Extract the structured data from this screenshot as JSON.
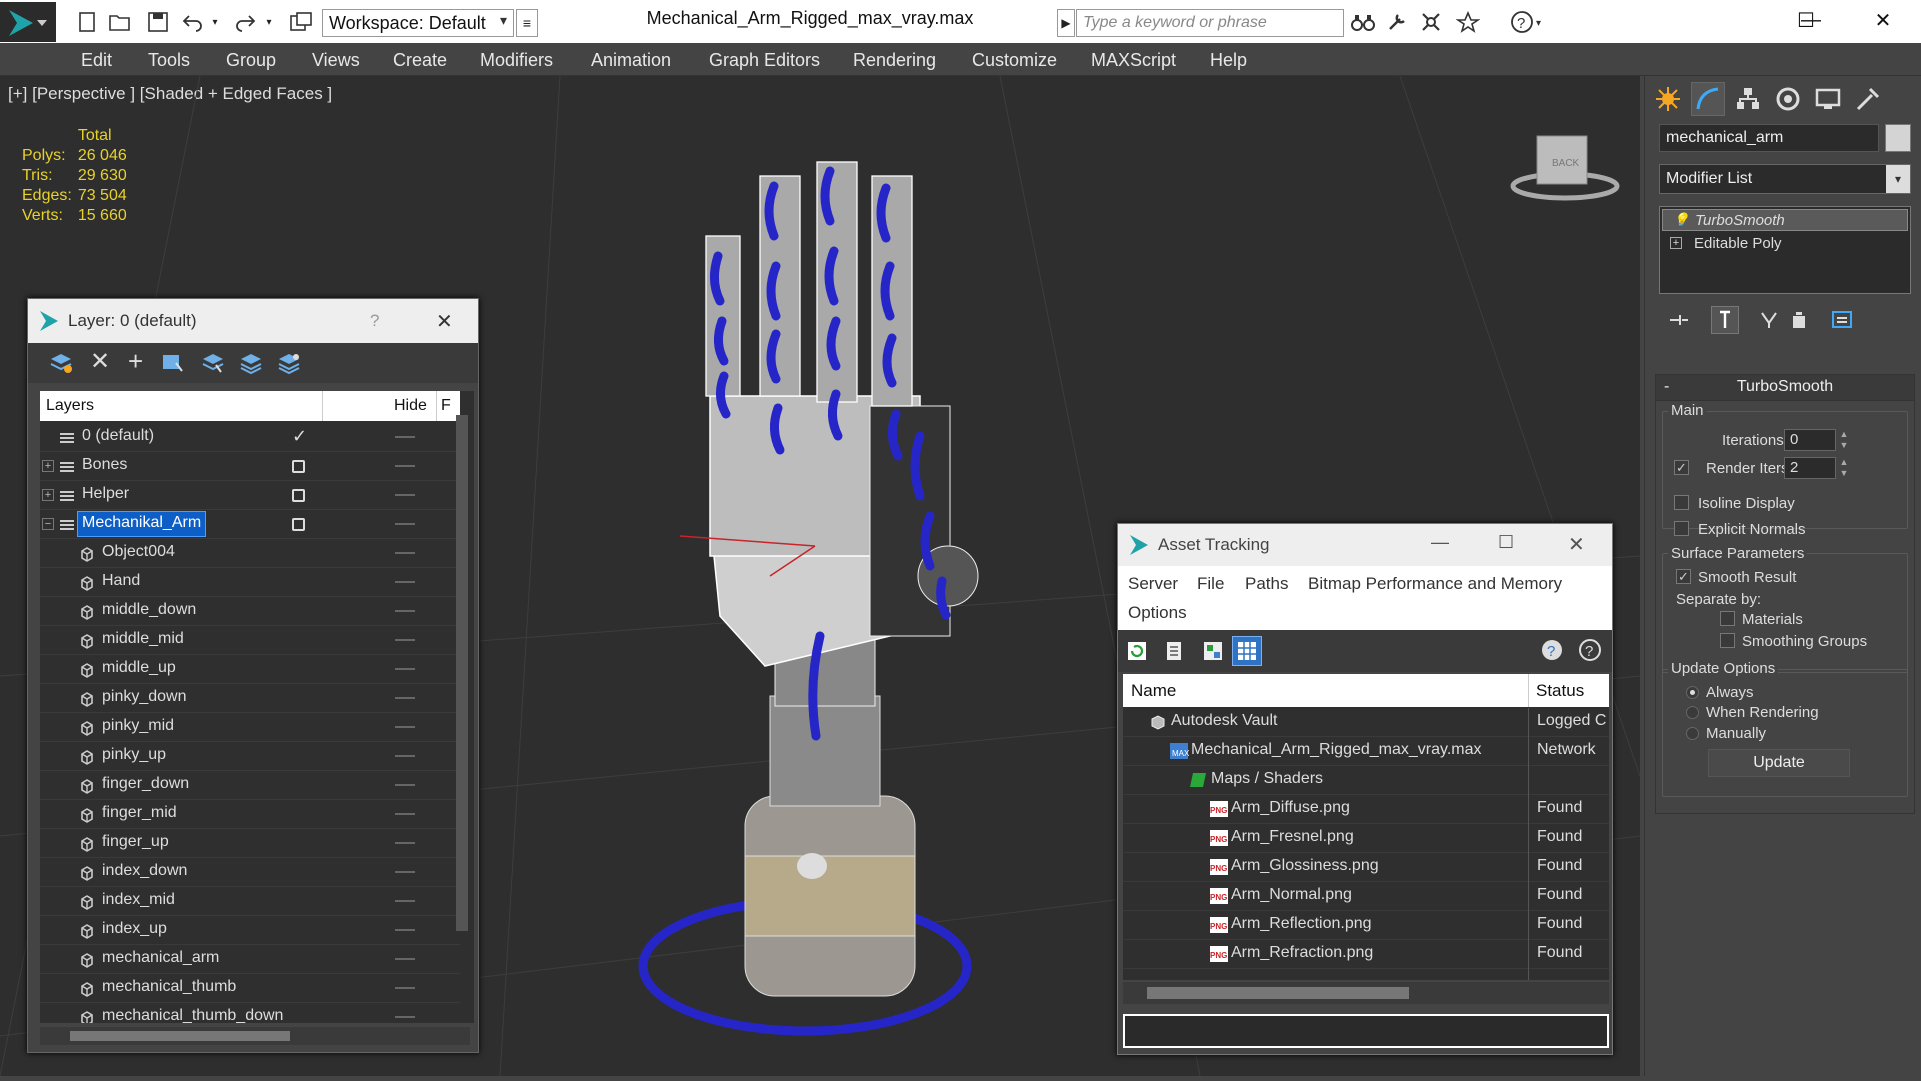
{
  "titlebar": {
    "workspace": "Workspace: Default",
    "doc_title": "Mechanical_Arm_Rigged_max_vray.max",
    "search_placeholder": "Type a keyword or phrase",
    "win_min": "—",
    "win_max": "☐",
    "win_close": "✕"
  },
  "menubar": [
    "Edit",
    "Tools",
    "Group",
    "Views",
    "Create",
    "Modifiers",
    "Animation",
    "Graph Editors",
    "Rendering",
    "Customize",
    "MAXScript",
    "Help"
  ],
  "viewport": {
    "label": "[+] [Perspective ] [Shaded + Edged Faces ]",
    "stats_header": "Total",
    "stats": [
      {
        "label": "Polys:",
        "value": "26 046"
      },
      {
        "label": "Tris:",
        "value": "29 630"
      },
      {
        "label": "Edges:",
        "value": "73 504"
      },
      {
        "label": "Verts:",
        "value": "15 660"
      }
    ],
    "viewcube_label": "BACK"
  },
  "command_panel": {
    "object_name": "mechanical_arm",
    "modifier_list": "Modifier List",
    "stack": [
      "TurboSmooth",
      "Editable Poly"
    ],
    "rollout_title": "TurboSmooth",
    "rollout_collapse": "-",
    "main_group": "Main",
    "iterations_label": "Iterations:",
    "iterations_value": "0",
    "render_iters_label": "Render Iters:",
    "render_iters_value": "2",
    "isoline": "Isoline Display",
    "explicit_normals": "Explicit Normals",
    "surface_group": "Surface Parameters",
    "smooth_result": "Smooth Result",
    "separate_by": "Separate by:",
    "materials": "Materials",
    "smoothing_groups": "Smoothing Groups",
    "update_group": "Update Options",
    "always": "Always",
    "when_rendering": "When Rendering",
    "manually": "Manually",
    "update_button": "Update"
  },
  "layer_window": {
    "title": "Layer: 0 (default)",
    "help": "?",
    "close": "✕",
    "col_layers": "Layers",
    "col_hide": "Hide",
    "col_f": "F",
    "rows": [
      {
        "name": "0 (default)",
        "level": 0,
        "expand": "",
        "type": "layer",
        "check": "✓"
      },
      {
        "name": "Bones",
        "level": 0,
        "expand": "+",
        "type": "layer",
        "check": "box"
      },
      {
        "name": "Helper",
        "level": 0,
        "expand": "+",
        "type": "layer",
        "check": "box"
      },
      {
        "name": "Mechanikal_Arm",
        "level": 0,
        "expand": "−",
        "type": "layer",
        "check": "box",
        "selected": true
      },
      {
        "name": "Object004",
        "level": 1,
        "type": "obj"
      },
      {
        "name": "Hand",
        "level": 1,
        "type": "obj"
      },
      {
        "name": "middle_down",
        "level": 1,
        "type": "obj"
      },
      {
        "name": "middle_mid",
        "level": 1,
        "type": "obj"
      },
      {
        "name": "middle_up",
        "level": 1,
        "type": "obj"
      },
      {
        "name": "pinky_down",
        "level": 1,
        "type": "obj"
      },
      {
        "name": "pinky_mid",
        "level": 1,
        "type": "obj"
      },
      {
        "name": "pinky_up",
        "level": 1,
        "type": "obj"
      },
      {
        "name": "finger_down",
        "level": 1,
        "type": "obj"
      },
      {
        "name": "finger_mid",
        "level": 1,
        "type": "obj"
      },
      {
        "name": "finger_up",
        "level": 1,
        "type": "obj"
      },
      {
        "name": "index_down",
        "level": 1,
        "type": "obj"
      },
      {
        "name": "index_mid",
        "level": 1,
        "type": "obj"
      },
      {
        "name": "index_up",
        "level": 1,
        "type": "obj"
      },
      {
        "name": "mechanical_arm",
        "level": 1,
        "type": "obj"
      },
      {
        "name": "mechanical_thumb",
        "level": 1,
        "type": "obj"
      },
      {
        "name": "mechanical_thumb_down",
        "level": 1,
        "type": "obj"
      }
    ]
  },
  "asset_window": {
    "title": "Asset Tracking",
    "min": "—",
    "max": "☐",
    "close": "✕",
    "menu": [
      "Server",
      "File",
      "Paths",
      "Bitmap Performance and Memory",
      "Options"
    ],
    "col_name": "Name",
    "col_status": "Status",
    "rows": [
      {
        "name": "Autodesk Vault",
        "level": 1,
        "icon": "vault",
        "status": "Logged C"
      },
      {
        "name": "Mechanical_Arm_Rigged_max_vray.max",
        "level": 2,
        "icon": "max",
        "status": "Network"
      },
      {
        "name": "Maps / Shaders",
        "level": 3,
        "icon": "maps",
        "status": ""
      },
      {
        "name": "Arm_Diffuse.png",
        "level": 4,
        "icon": "png",
        "status": "Found"
      },
      {
        "name": "Arm_Fresnel.png",
        "level": 4,
        "icon": "png",
        "status": "Found"
      },
      {
        "name": "Arm_Glossiness.png",
        "level": 4,
        "icon": "png",
        "status": "Found"
      },
      {
        "name": "Arm_Normal.png",
        "level": 4,
        "icon": "png",
        "status": "Found"
      },
      {
        "name": "Arm_Reflection.png",
        "level": 4,
        "icon": "png",
        "status": "Found"
      },
      {
        "name": "Arm_Refraction.png",
        "level": 4,
        "icon": "png",
        "status": "Found"
      }
    ]
  },
  "colors": {
    "accent": "#0d5fc7",
    "stats": "#e8d22a",
    "wire": "#2626c8"
  }
}
